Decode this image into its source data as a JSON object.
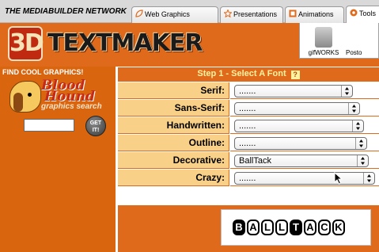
{
  "topnav": {
    "network_title": "THE MEDIABUILDER NETWORK",
    "tabs": [
      {
        "label": "Web Graphics",
        "icon": "leaf-icon"
      },
      {
        "label": "Presentations",
        "icon": "star-icon"
      },
      {
        "label": "Animations",
        "icon": "film-icon"
      },
      {
        "label": "Tools",
        "icon": "tools-icon"
      }
    ]
  },
  "header": {
    "logo_3d": "3D",
    "logo_text": "TEXTMAKER",
    "tools": [
      {
        "label": "gifWORKS"
      },
      {
        "label": "Posto"
      }
    ]
  },
  "sidebar": {
    "find_cool": "FIND COOL GRAPHICS!",
    "brand_line1": "Blood",
    "brand_line2": "Hound",
    "brand_tagline": "graphics search",
    "search_value": "",
    "get_button": "GET IT!"
  },
  "form": {
    "step_title": "Step 1 - Select A Font",
    "help_label": "?",
    "rows": [
      {
        "label": "Serif:",
        "value": "......."
      },
      {
        "label": "Sans-Serif:",
        "value": "......."
      },
      {
        "label": "Handwritten:",
        "value": "......."
      },
      {
        "label": "Outline:",
        "value": "......."
      },
      {
        "label": "Decorative:",
        "value": "BallTack"
      },
      {
        "label": "Crazy:",
        "value": "......."
      }
    ],
    "arrow_glyph": "▲▼"
  },
  "preview": {
    "letters": [
      "B",
      "A",
      "L",
      "L",
      "T",
      "A",
      "C",
      "K"
    ]
  },
  "colors": {
    "brand_orange": "#e06a1b",
    "label_bg": "#f8d088",
    "step_text": "#fff3a0"
  }
}
